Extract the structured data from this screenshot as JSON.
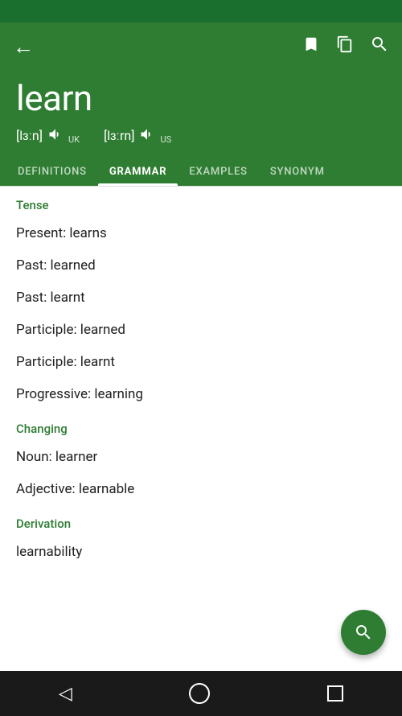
{
  "statusBar": {},
  "header": {
    "backLabel": "←",
    "bookmarkIcon": "bookmark-icon",
    "copyIcon": "copy-icon",
    "searchIcon": "search-icon"
  },
  "wordSection": {
    "word": "learn",
    "pronunciations": [
      {
        "ipa": "[lɜːn]",
        "region": "UK"
      },
      {
        "ipa": "[lɜːrn]",
        "region": "US"
      }
    ]
  },
  "tabs": [
    {
      "label": "DEFINITIONS",
      "active": false
    },
    {
      "label": "GRAMMAR",
      "active": true
    },
    {
      "label": "EXAMPLES",
      "active": false
    },
    {
      "label": "SYNONYM",
      "active": false
    }
  ],
  "grammar": {
    "sections": [
      {
        "header": "Tense",
        "items": [
          "Present: learns",
          "Past: learned",
          "Past: learnt",
          "Participle: learned",
          "Participle: learnt",
          "Progressive: learning"
        ]
      },
      {
        "header": "Changing",
        "items": [
          "Noun: learner",
          "Adjective: learnable"
        ]
      },
      {
        "header": "Derivation",
        "items": [
          "learnability"
        ]
      }
    ]
  },
  "fab": {
    "icon": "search",
    "label": "Search"
  },
  "bottomNav": {
    "back": "◁",
    "home": "○",
    "recent": "□"
  }
}
